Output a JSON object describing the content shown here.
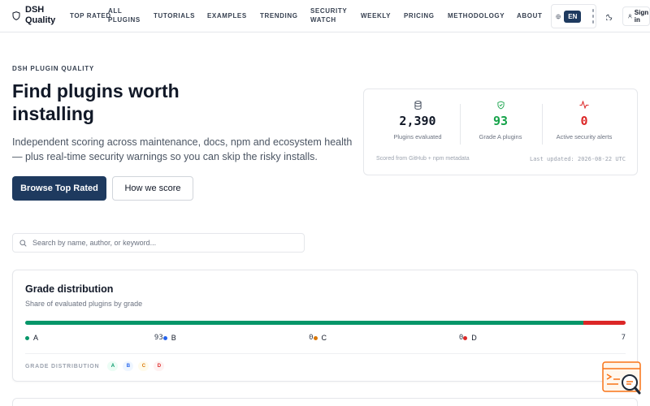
{
  "nav": {
    "brand": "DSH Quality",
    "links": [
      {
        "id": "top-rated",
        "label": "TOP RATED"
      },
      {
        "id": "all-plugins",
        "label": "ALL PLUGINS"
      },
      {
        "id": "tutorials",
        "label": "TUTORIALS"
      },
      {
        "id": "examples",
        "label": "EXAMPLES"
      },
      {
        "id": "trending",
        "label": "TRENDING"
      },
      {
        "id": "security-watch",
        "label": "SECURITY WATCH"
      },
      {
        "id": "weekly",
        "label": "WEEKLY"
      },
      {
        "id": "pricing",
        "label": "PRICING"
      },
      {
        "id": "methodology",
        "label": "METHODOLOGY"
      },
      {
        "id": "about",
        "label": "ABOUT"
      }
    ],
    "language": "EN",
    "signin": "Sign in"
  },
  "hero": {
    "eyebrow": "DSH PLUGIN QUALITY",
    "title": "Find plugins worth installing",
    "subtitle": "Independent scoring across maintenance, docs, npm and ecosystem health — plus real-time security warnings so you can skip the risky installs.",
    "primary_button": "Browse Top Rated",
    "secondary_button": "How we score"
  },
  "stats": {
    "items": [
      {
        "icon": "database-icon",
        "value": "2,390",
        "label": "Plugins evaluated",
        "color": "#111827"
      },
      {
        "icon": "shield-check-icon",
        "value": "93",
        "label": "Grade A plugins",
        "color": "#16a34a"
      },
      {
        "icon": "activity-icon",
        "value": "0",
        "label": "Active security alerts",
        "color": "#dc2626"
      }
    ],
    "footer_left": "Scored from GitHub + npm metadata",
    "footer_right": "Last updated: 2026-08-22 UTC"
  },
  "search": {
    "placeholder": "Search by name, author, or keyword..."
  },
  "grade_distribution": {
    "title": "Grade distribution",
    "subtitle": "Share of evaluated plugins by grade",
    "grades": [
      {
        "label": "A",
        "count": "93",
        "color": "#059669",
        "chip_bg": "#ecfdf5"
      },
      {
        "label": "B",
        "count": "0",
        "color": "#2563eb",
        "chip_bg": "#eff6ff"
      },
      {
        "label": "C",
        "count": "0",
        "color": "#d97706",
        "chip_bg": "#fffbeb"
      },
      {
        "label": "D",
        "count": "7",
        "color": "#dc2626",
        "chip_bg": "#fef2f2"
      }
    ],
    "footer_label": "GRADE DISTRIBUTION"
  },
  "colors": {
    "primary": "#1e3a5f",
    "widget": "#f97316"
  }
}
